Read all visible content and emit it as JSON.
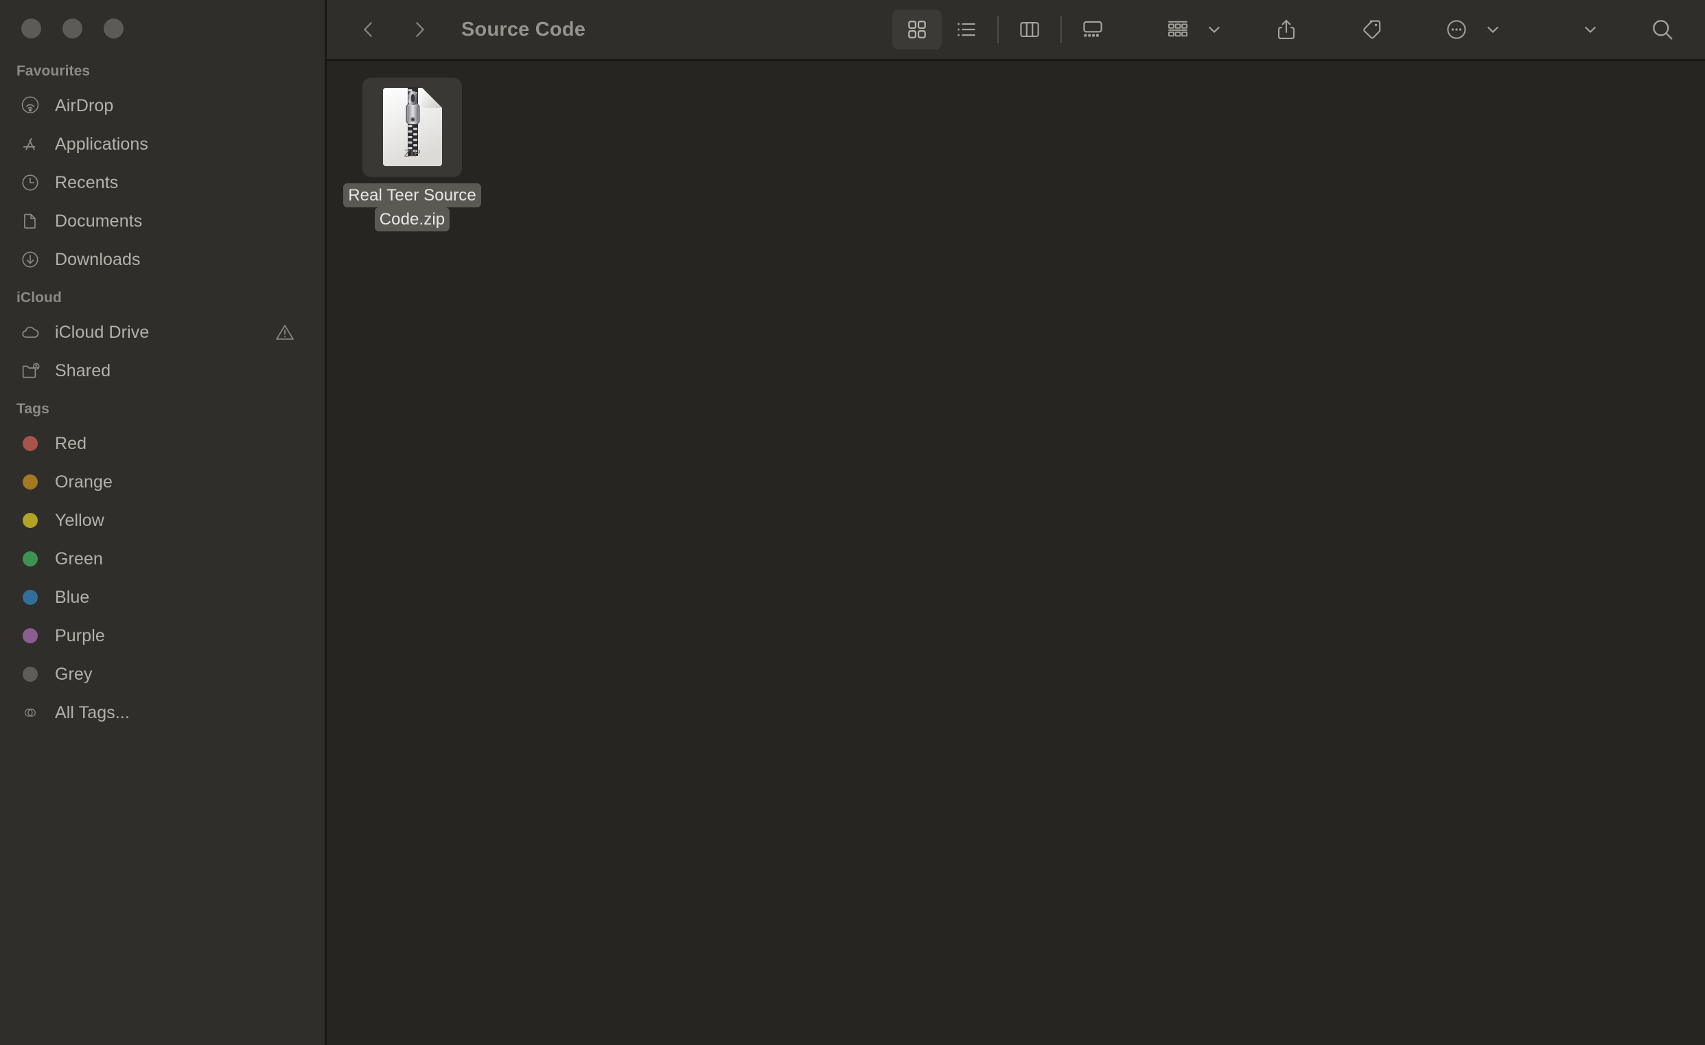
{
  "window": {
    "title": "Source Code",
    "traffic_lights": [
      "close",
      "minimize",
      "maximize"
    ]
  },
  "toolbar": {
    "back_label": "Back",
    "forward_label": "Forward",
    "title": "Source Code",
    "view_modes": [
      {
        "name": "icon-view",
        "label": "Icon View",
        "selected": true
      },
      {
        "name": "list-view",
        "label": "List View",
        "selected": false
      },
      {
        "name": "column-view",
        "label": "Column View",
        "selected": false
      },
      {
        "name": "gallery-view",
        "label": "Gallery View",
        "selected": false
      }
    ],
    "group_label": "Group",
    "share_label": "Share",
    "tags_label": "Tags",
    "more_label": "More",
    "search_label": "Search"
  },
  "sidebar": {
    "sections": [
      {
        "header": "Favourites",
        "items": [
          {
            "label": "AirDrop",
            "icon": "airdrop-icon"
          },
          {
            "label": "Applications",
            "icon": "applications-icon"
          },
          {
            "label": "Recents",
            "icon": "clock-icon"
          },
          {
            "label": "Documents",
            "icon": "document-icon"
          },
          {
            "label": "Downloads",
            "icon": "download-icon"
          }
        ]
      },
      {
        "header": "iCloud",
        "items": [
          {
            "label": "iCloud Drive",
            "icon": "cloud-icon",
            "badge": "warning-icon"
          },
          {
            "label": "Shared",
            "icon": "shared-folder-icon"
          }
        ]
      },
      {
        "header": "Tags",
        "items": [
          {
            "label": "Red",
            "icon": "tag-dot",
            "color": "#a9534d"
          },
          {
            "label": "Orange",
            "icon": "tag-dot",
            "color": "#a37a22"
          },
          {
            "label": "Yellow",
            "icon": "tag-dot",
            "color": "#b0a426"
          },
          {
            "label": "Green",
            "icon": "tag-dot",
            "color": "#3d9354"
          },
          {
            "label": "Blue",
            "icon": "tag-dot",
            "color": "#2f6f99"
          },
          {
            "label": "Purple",
            "icon": "tag-dot",
            "color": "#8c5d91"
          },
          {
            "label": "Grey",
            "icon": "tag-dot",
            "color": "#5e5d59"
          },
          {
            "label": "All Tags...",
            "icon": "all-tags-icon",
            "color": null
          }
        ]
      }
    ]
  },
  "content": {
    "files": [
      {
        "name_line1": "Real Teer Source",
        "name_line2": "Code.zip",
        "full_name": "Real Teer Source Code.zip",
        "type_label": "ZIP",
        "icon": "zip-archive-icon",
        "selected": true
      }
    ]
  },
  "colors": {
    "sidebar_bg": "#302e2b",
    "content_bg": "#262521",
    "toolbar_bg": "#302e2b",
    "text": "#b4b1aa",
    "header_text": "#8d8a84",
    "selection": "#5a5954"
  }
}
